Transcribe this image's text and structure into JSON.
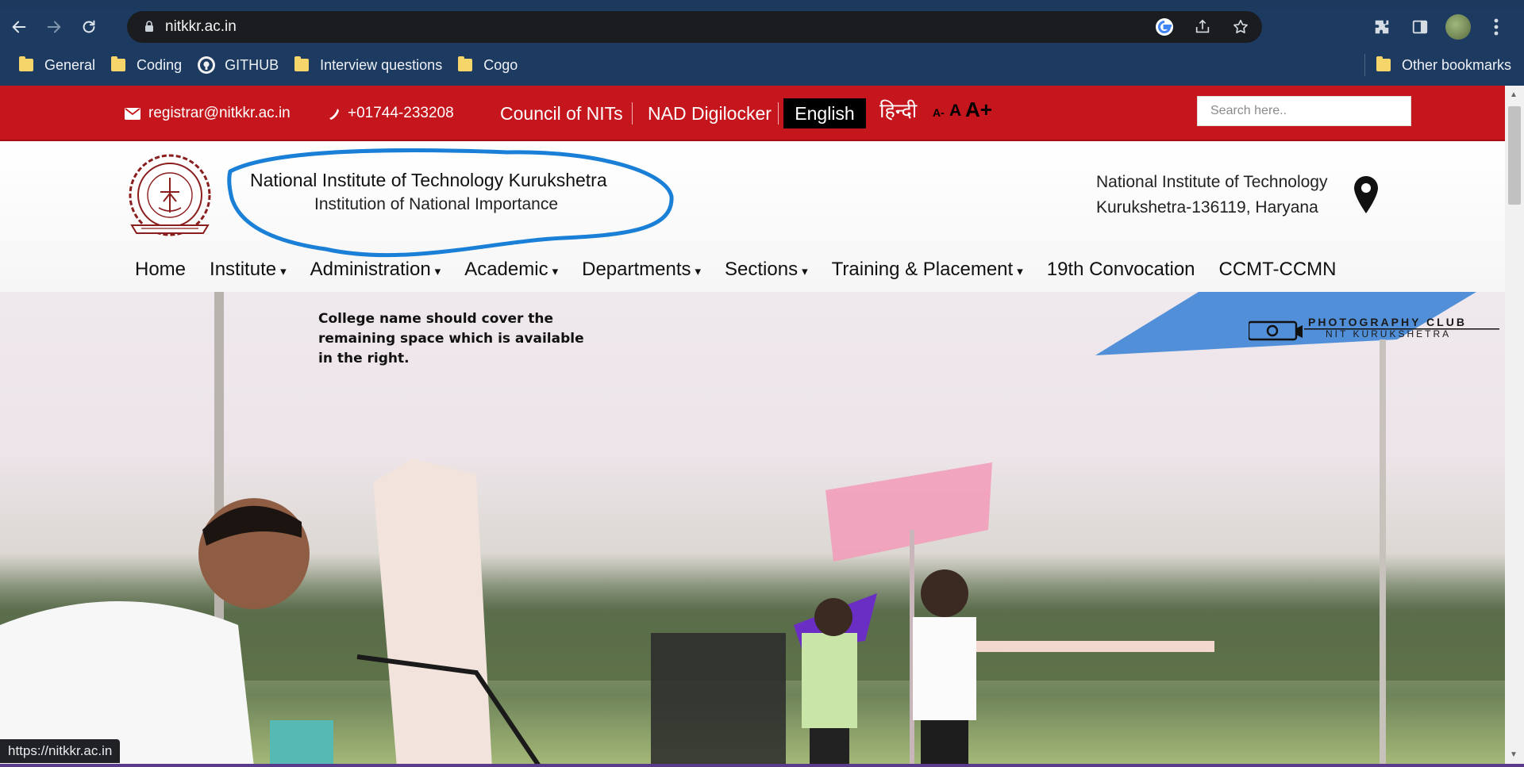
{
  "browser": {
    "url": "nitkkr.ac.in",
    "status_url": "https://nitkkr.ac.in",
    "bookmarks": [
      "General",
      "Coding",
      "GITHUB",
      "Interview questions",
      "Cogo"
    ],
    "other_bookmarks": "Other bookmarks"
  },
  "topbar": {
    "email": "registrar@nitkkr.ac.in",
    "phone": "+01744-233208",
    "council": "Council of NITs",
    "nad": "NAD Digilocker",
    "lang_en": "English",
    "lang_hi": "हिन्दी",
    "font_small": "A-",
    "font_normal": "A",
    "font_large": "A+",
    "search_placeholder": "Search here.."
  },
  "header": {
    "name": "National Institute of Technology Kurukshetra",
    "subtitle": "Institution of National Importance",
    "address_line1": "National Institute of Technology",
    "address_line2": "Kurukshetra-136119, Haryana"
  },
  "menu": [
    {
      "label": "Home",
      "caret": ""
    },
    {
      "label": "Institute",
      "caret": "▾"
    },
    {
      "label": "Administration",
      "caret": "▾"
    },
    {
      "label": "Academic",
      "caret": "▾"
    },
    {
      "label": "Departments",
      "caret": "▾"
    },
    {
      "label": "Sections",
      "caret": "▾"
    },
    {
      "label": "Training & Placement",
      "caret": "▾"
    },
    {
      "label": "19th Convocation",
      "caret": ""
    },
    {
      "label": "CCMT-CCMN",
      "caret": ""
    }
  ],
  "hero": {
    "annotation": "College name should cover the remaining space which is available in the right.",
    "photo_club_line1": "PHOTOGRAPHY CLUB",
    "photo_club_line2": "NIT KURUKSHETRA"
  },
  "colors": {
    "topbar_red": "#c4161c",
    "chrome_blue": "#1d3a60",
    "annotation_circle": "#1a7fd6"
  }
}
